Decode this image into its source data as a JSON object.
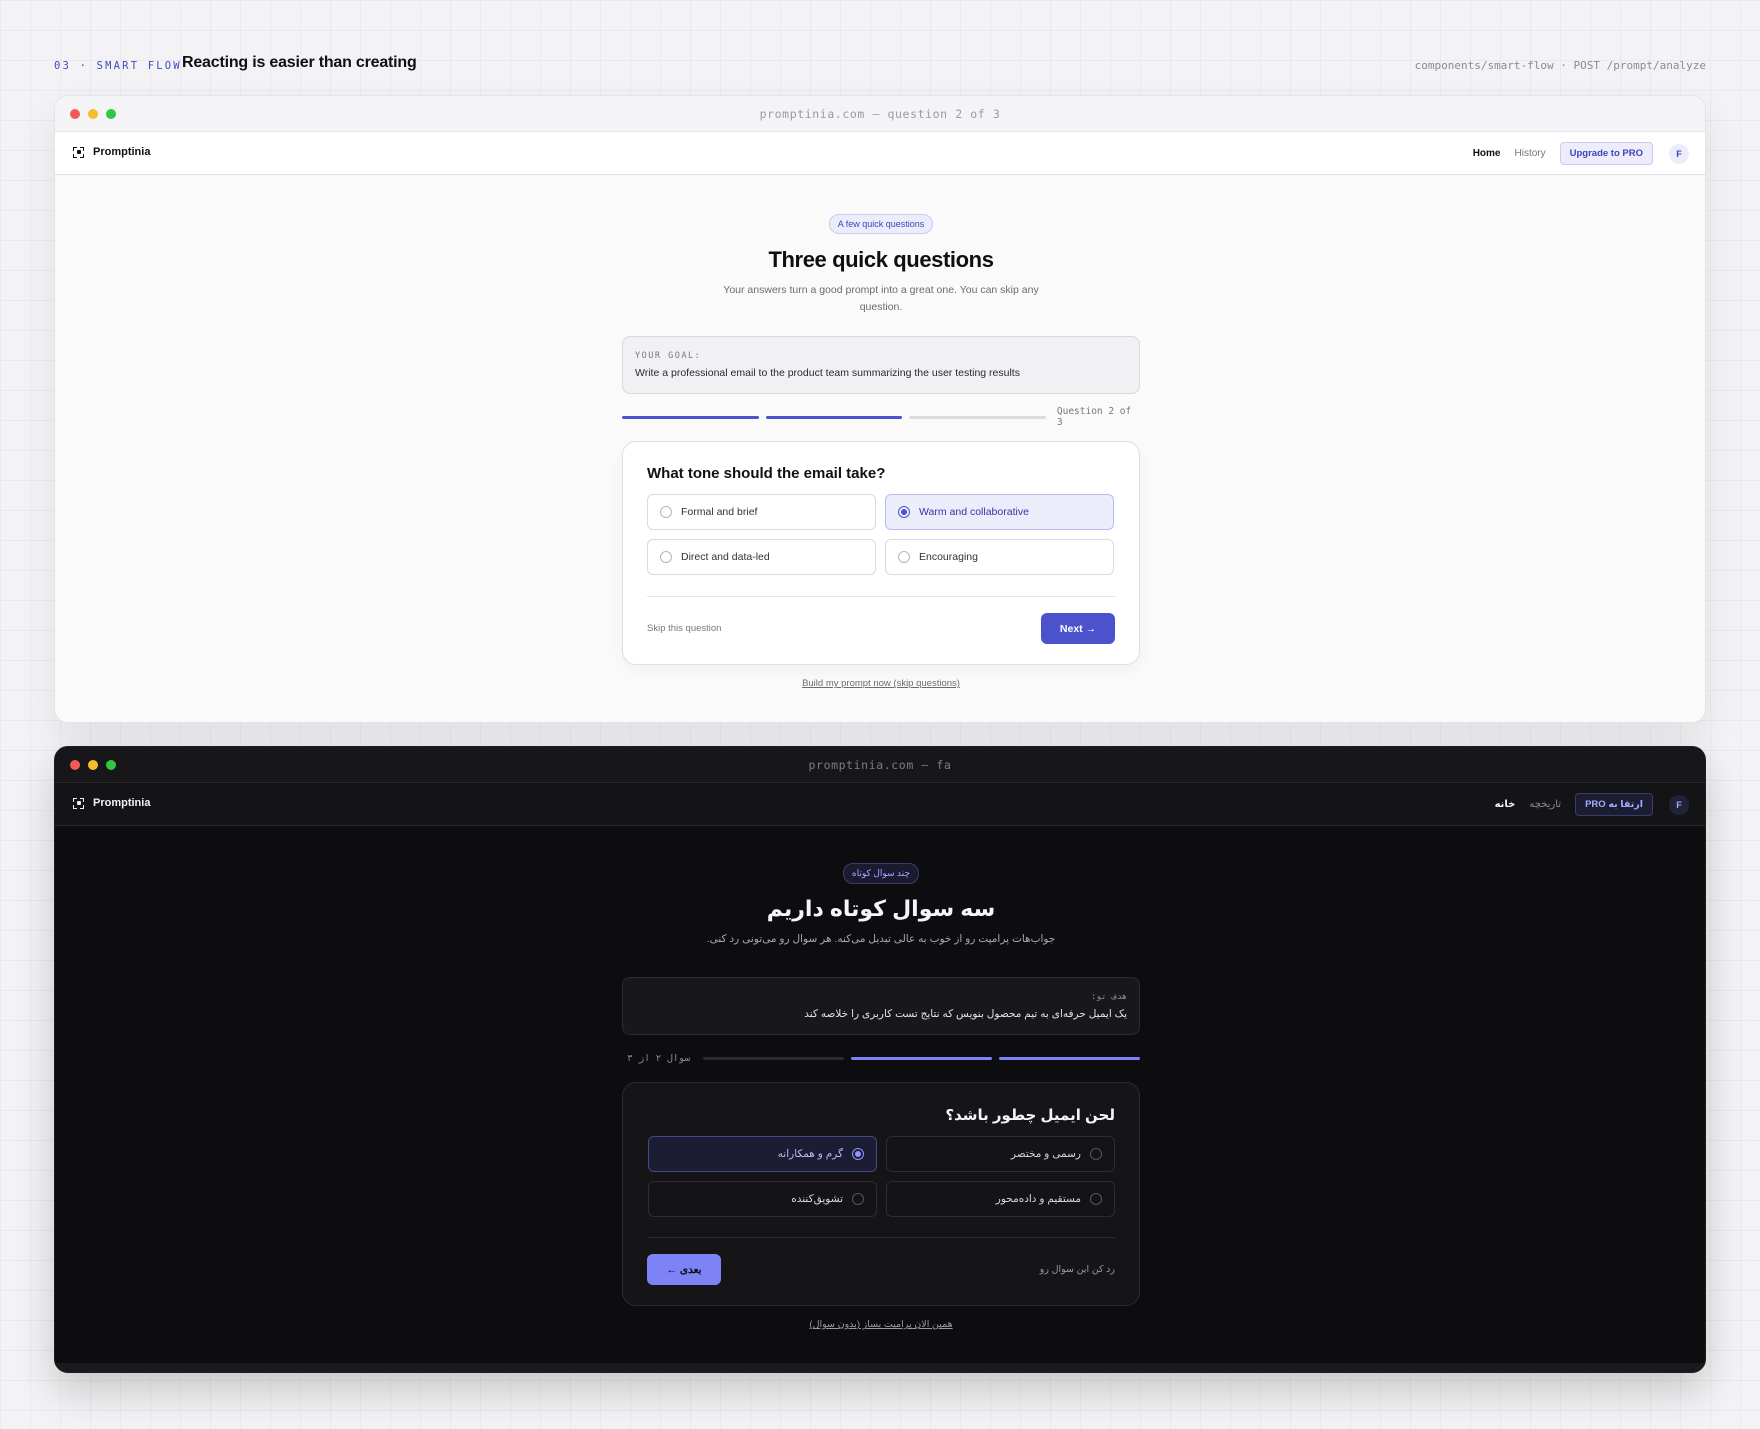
{
  "page_header": {
    "section_tag": "03 · SMART FLOW",
    "title": "Reacting is easier than creating",
    "path": "components/smart-flow · POST /prompt/analyze"
  },
  "colors": {
    "accent_light": "#4b52cc",
    "accent_dark": "#7d83f7",
    "traffic_red": "#f05b57",
    "traffic_yellow": "#f6bd2f",
    "traffic_green": "#2fc840"
  },
  "light": {
    "window_title": "promptinia.com — question 2 of 3",
    "brand": "Promptinia",
    "nav": {
      "home": "Home",
      "history": "History",
      "upgrade": "Upgrade to PRO",
      "avatar": "F"
    },
    "pill": "A few quick questions",
    "headline": "Three quick questions",
    "subline": "Your answers turn a good prompt into a great one. You can skip any question.",
    "goal_label": "YOUR GOAL:",
    "goal_text": "Write a professional email to the product team summarizing the user testing results",
    "progress": {
      "current": 2,
      "total": 3,
      "label": "Question 2 of 3"
    },
    "question": "What tone should the email take?",
    "options": [
      "Formal and brief",
      "Warm and collaborative",
      "Direct and data-led",
      "Encouraging"
    ],
    "selected_option": "Warm and collaborative",
    "skip_label": "Skip this question",
    "next_label": "Next →",
    "build_link": "Build my prompt now (skip questions)"
  },
  "dark": {
    "window_title": "promptinia.com — fa",
    "brand": "Promptinia",
    "nav": {
      "home": "خانه",
      "history": "تاریخچه",
      "upgrade": "ارتقا به PRO",
      "avatar": "F"
    },
    "pill": "چند سوال کوتاه",
    "headline": "سه سوال کوتاه داریم",
    "subline": "جواب‌هات پرامپت رو از خوب به عالی تبدیل می‌کنه. هر سوال رو می‌تونی رد کنی.",
    "goal_label": "هدف تو:",
    "goal_text": "یک ایمیل حرفه‌ای به تیم محصول بنویس که نتایج تست کاربری را خلاصه کند",
    "progress": {
      "current": 2,
      "total": 3,
      "label": "سوال ۲ از ۳"
    },
    "question": "لحن ایمیل چطور باشد؟",
    "options": [
      "رسمی و مختصر",
      "گرم و همکارانه",
      "مستقیم و داده‌محور",
      "تشویق‌کننده"
    ],
    "selected_option": "گرم و همکارانه",
    "skip_label": "رد کن این سوال رو",
    "next_label": "بعدی ←",
    "build_link": "همین الان پرامپت بساز (بدون سوال)"
  }
}
